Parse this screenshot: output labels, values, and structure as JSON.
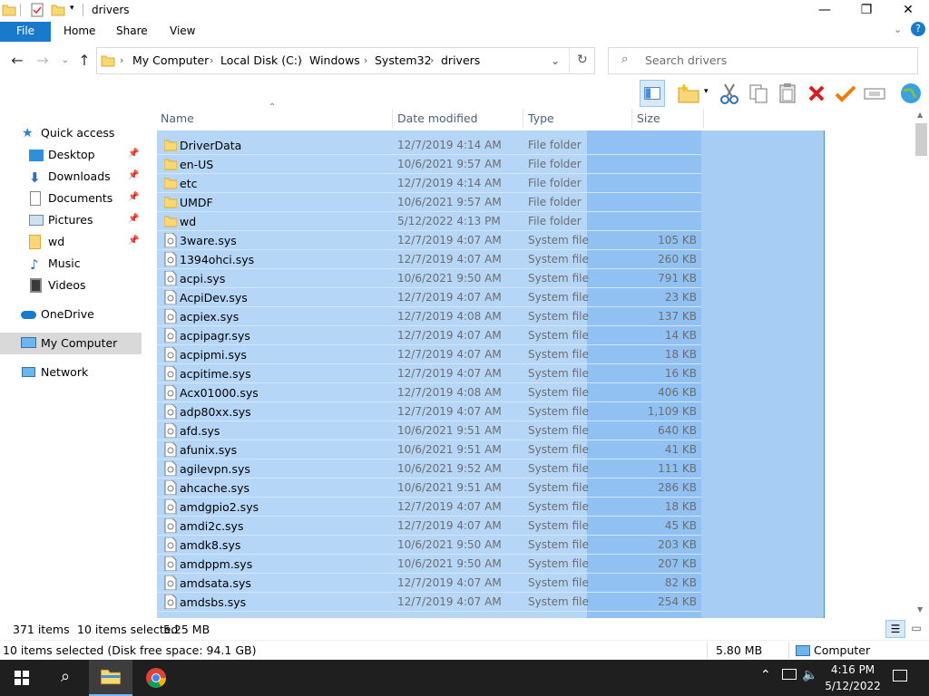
{
  "window": {
    "title": "drivers"
  },
  "ribbon": {
    "tabs": [
      "File",
      "Home",
      "Share",
      "View"
    ]
  },
  "address": {
    "segments": [
      "My Computer",
      "Local Disk (C:)",
      "Windows",
      "System32",
      "drivers"
    ]
  },
  "search": {
    "placeholder": "Search drivers"
  },
  "nav": {
    "quick_access": "Quick access",
    "items": [
      "Desktop",
      "Downloads",
      "Documents",
      "Pictures",
      "wd",
      "Music",
      "Videos"
    ],
    "onedrive": "OneDrive",
    "computer": "My Computer",
    "network": "Network"
  },
  "columns": {
    "name": "Name",
    "date": "Date modified",
    "type": "Type",
    "size": "Size"
  },
  "files": [
    {
      "name": "DriverData",
      "date": "12/7/2019 4:14 AM",
      "type": "File folder",
      "size": "",
      "kind": "folder"
    },
    {
      "name": "en-US",
      "date": "10/6/2021 9:57 AM",
      "type": "File folder",
      "size": "",
      "kind": "folder"
    },
    {
      "name": "etc",
      "date": "12/7/2019 4:14 AM",
      "type": "File folder",
      "size": "",
      "kind": "folder"
    },
    {
      "name": "UMDF",
      "date": "10/6/2021 9:57 AM",
      "type": "File folder",
      "size": "",
      "kind": "folder"
    },
    {
      "name": "wd",
      "date": "5/12/2022 4:13 PM",
      "type": "File folder",
      "size": "",
      "kind": "folder"
    },
    {
      "name": "3ware.sys",
      "date": "12/7/2019 4:07 AM",
      "type": "System file",
      "size": "105 KB",
      "kind": "file"
    },
    {
      "name": "1394ohci.sys",
      "date": "12/7/2019 4:07 AM",
      "type": "System file",
      "size": "260 KB",
      "kind": "file"
    },
    {
      "name": "acpi.sys",
      "date": "10/6/2021 9:50 AM",
      "type": "System file",
      "size": "791 KB",
      "kind": "file"
    },
    {
      "name": "AcpiDev.sys",
      "date": "12/7/2019 4:07 AM",
      "type": "System file",
      "size": "23 KB",
      "kind": "file"
    },
    {
      "name": "acpiex.sys",
      "date": "12/7/2019 4:08 AM",
      "type": "System file",
      "size": "137 KB",
      "kind": "file"
    },
    {
      "name": "acpipagr.sys",
      "date": "12/7/2019 4:07 AM",
      "type": "System file",
      "size": "14 KB",
      "kind": "file"
    },
    {
      "name": "acpipmi.sys",
      "date": "12/7/2019 4:07 AM",
      "type": "System file",
      "size": "18 KB",
      "kind": "file"
    },
    {
      "name": "acpitime.sys",
      "date": "12/7/2019 4:07 AM",
      "type": "System file",
      "size": "16 KB",
      "kind": "file"
    },
    {
      "name": "Acx01000.sys",
      "date": "12/7/2019 4:08 AM",
      "type": "System file",
      "size": "406 KB",
      "kind": "file"
    },
    {
      "name": "adp80xx.sys",
      "date": "12/7/2019 4:07 AM",
      "type": "System file",
      "size": "1,109 KB",
      "kind": "file"
    },
    {
      "name": "afd.sys",
      "date": "10/6/2021 9:51 AM",
      "type": "System file",
      "size": "640 KB",
      "kind": "file"
    },
    {
      "name": "afunix.sys",
      "date": "10/6/2021 9:51 AM",
      "type": "System file",
      "size": "41 KB",
      "kind": "file"
    },
    {
      "name": "agilevpn.sys",
      "date": "10/6/2021 9:52 AM",
      "type": "System file",
      "size": "111 KB",
      "kind": "file"
    },
    {
      "name": "ahcache.sys",
      "date": "10/6/2021 9:51 AM",
      "type": "System file",
      "size": "286 KB",
      "kind": "file"
    },
    {
      "name": "amdgpio2.sys",
      "date": "12/7/2019 4:07 AM",
      "type": "System file",
      "size": "18 KB",
      "kind": "file"
    },
    {
      "name": "amdi2c.sys",
      "date": "12/7/2019 4:07 AM",
      "type": "System file",
      "size": "45 KB",
      "kind": "file"
    },
    {
      "name": "amdk8.sys",
      "date": "10/6/2021 9:50 AM",
      "type": "System file",
      "size": "203 KB",
      "kind": "file"
    },
    {
      "name": "amdppm.sys",
      "date": "10/6/2021 9:50 AM",
      "type": "System file",
      "size": "207 KB",
      "kind": "file"
    },
    {
      "name": "amdsata.sys",
      "date": "12/7/2019 4:07 AM",
      "type": "System file",
      "size": "82 KB",
      "kind": "file"
    },
    {
      "name": "amdsbs.sys",
      "date": "12/7/2019 4:07 AM",
      "type": "System file",
      "size": "254 KB",
      "kind": "file"
    }
  ],
  "status": {
    "items": "371 items",
    "selected": "10 items selected",
    "sel_size": "5.25 MB"
  },
  "details": {
    "text": "10 items selected (Disk free space: 94.1 GB)",
    "size": "5.80 MB",
    "location": "Computer"
  },
  "clock": {
    "time": "4:16 PM",
    "date": "5/12/2022"
  },
  "colors": {
    "accent": "#1979ca",
    "selection": "#b6d6f7",
    "taskbar": "#1f1f1f"
  }
}
